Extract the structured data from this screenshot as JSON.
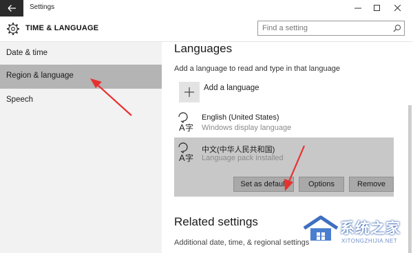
{
  "window": {
    "title": "Settings"
  },
  "header": {
    "title": "TIME & LANGUAGE",
    "search_placeholder": "Find a setting"
  },
  "sidebar": {
    "items": [
      {
        "label": "Date & time",
        "selected": false
      },
      {
        "label": "Region & language",
        "selected": true
      },
      {
        "label": "Speech",
        "selected": false
      }
    ]
  },
  "main": {
    "languages_heading": "Languages",
    "languages_desc": "Add a language to read and type in that language",
    "add_language_label": "Add a language",
    "languages": [
      {
        "name": "English (United States)",
        "status": "Windows display language",
        "selected": false
      },
      {
        "name": "中文(中华人民共和国)",
        "status": "Language pack installed",
        "selected": true
      }
    ],
    "buttons": {
      "set_default": "Set as default",
      "options": "Options",
      "remove": "Remove"
    },
    "related_heading": "Related settings",
    "related_link": "Additional date, time, & regional settings"
  },
  "watermark": {
    "text": "系统之家",
    "url": "XITONGZHIJIA.NET"
  },
  "colors": {
    "annotation_arrow": "#e8312f",
    "selected_item": "#b4b4b4",
    "titlebar_back": "#2b2b2b"
  },
  "icons": [
    "back-arrow-icon",
    "minimize-icon",
    "maximize-icon",
    "close-icon",
    "gear-icon",
    "search-icon",
    "plus-icon",
    "language-icon"
  ]
}
